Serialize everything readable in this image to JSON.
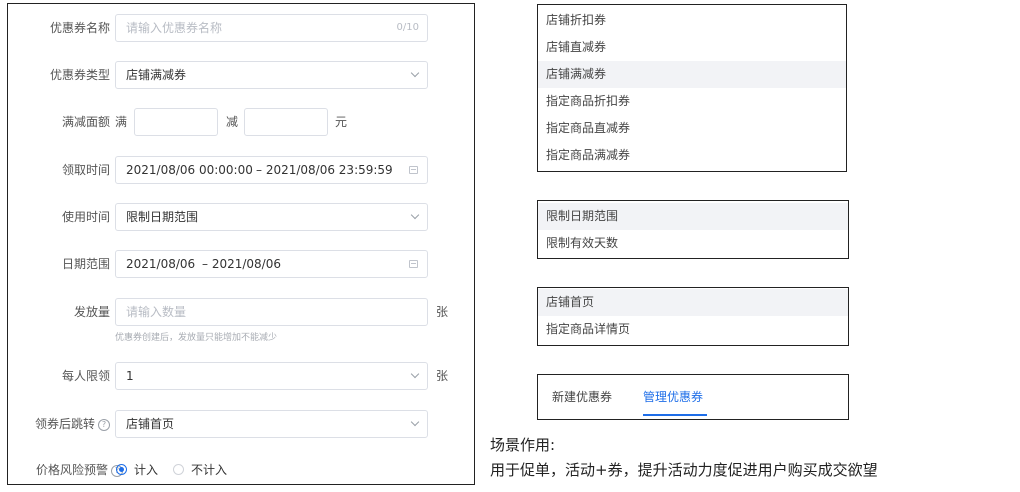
{
  "form": {
    "name": {
      "label": "优惠券名称",
      "placeholder": "请输入优惠券名称",
      "counter": "0/10"
    },
    "type": {
      "label": "优惠券类型",
      "value": "店铺满减券"
    },
    "threshold": {
      "label": "满减面额",
      "prefix": "满",
      "middle": "减",
      "suffix": "元"
    },
    "claim_time": {
      "label": "领取时间",
      "start": "2021/08/06 00:00:00",
      "end": "– 2021/08/06 23:59:59"
    },
    "use_time": {
      "label": "使用时间",
      "value": "限制日期范围"
    },
    "date_range": {
      "label": "日期范围",
      "start": "2021/08/06",
      "end": "– 2021/08/06"
    },
    "quantity": {
      "label": "发放量",
      "placeholder": "请输入数量",
      "suffix": "张",
      "hint": "优惠券创建后，发放量只能增加不能减少"
    },
    "per_user_limit": {
      "label": "每人限领",
      "value": "1",
      "suffix": "张"
    },
    "redirect": {
      "label": "领券后跳转",
      "value": "店铺首页"
    },
    "price_risk": {
      "label": "价格风险预警",
      "options": [
        "计入",
        "不计入"
      ],
      "selected": "计入"
    }
  },
  "dropdowns": {
    "coupon_types": [
      "店铺折扣券",
      "店铺直减券",
      "店铺满减券",
      "指定商品折扣券",
      "指定商品直减券",
      "指定商品满减券"
    ],
    "coupon_types_active": 2,
    "use_time_options": [
      "限制日期范围",
      "限制有效天数"
    ],
    "use_time_active": 0,
    "redirect_options": [
      "店铺首页",
      "指定商品详情页"
    ],
    "redirect_active": 0
  },
  "tabs": {
    "items": [
      "新建优惠券",
      "管理优惠券"
    ],
    "active": 1
  },
  "scene": {
    "title": "场景作用:",
    "description": "用于促单，活动+券，提升活动力度促进用户购买成交欲望"
  },
  "colors": {
    "accent": "#1e6ee8",
    "border": "#dcdfe6",
    "placeholder": "#b8bcc4"
  },
  "icons": {
    "select": "chevron-down-icon",
    "date": "calendar-icon",
    "help": "question-circle-icon"
  }
}
